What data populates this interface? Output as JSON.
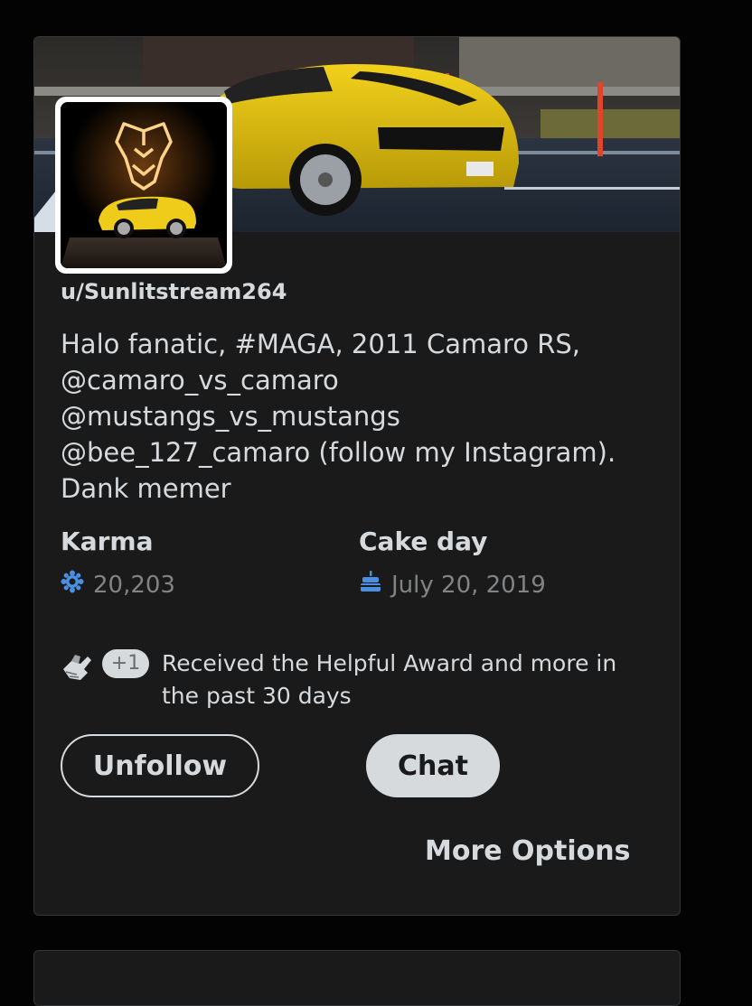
{
  "profile": {
    "username": "u/Sunlitstream264",
    "bio": "Halo fanatic, #MAGA, 2011 Camaro RS,\n@camaro_vs_camaro\n@mustangs_vs_mustangs\n@bee_127_camaro (follow my Instagram).\nDank memer"
  },
  "stats": {
    "karma_label": "Karma",
    "karma_value": "20,203",
    "cakeday_label": "Cake day",
    "cakeday_value": "July 20, 2019"
  },
  "award": {
    "badge": "+1",
    "text": "Received the Helpful Award and more in the past 30 days"
  },
  "actions": {
    "unfollow_label": "Unfollow",
    "chat_label": "Chat",
    "more_options_label": "More Options"
  },
  "colors": {
    "background": "#030303",
    "card": "#1a1a1b",
    "text": "#d7dadc",
    "muted": "#818384",
    "icon_blue": "#4a90e2"
  },
  "icons": {
    "karma": "karma-flower-icon",
    "cakeday": "cake-icon",
    "award": "helpful-award-icon"
  }
}
